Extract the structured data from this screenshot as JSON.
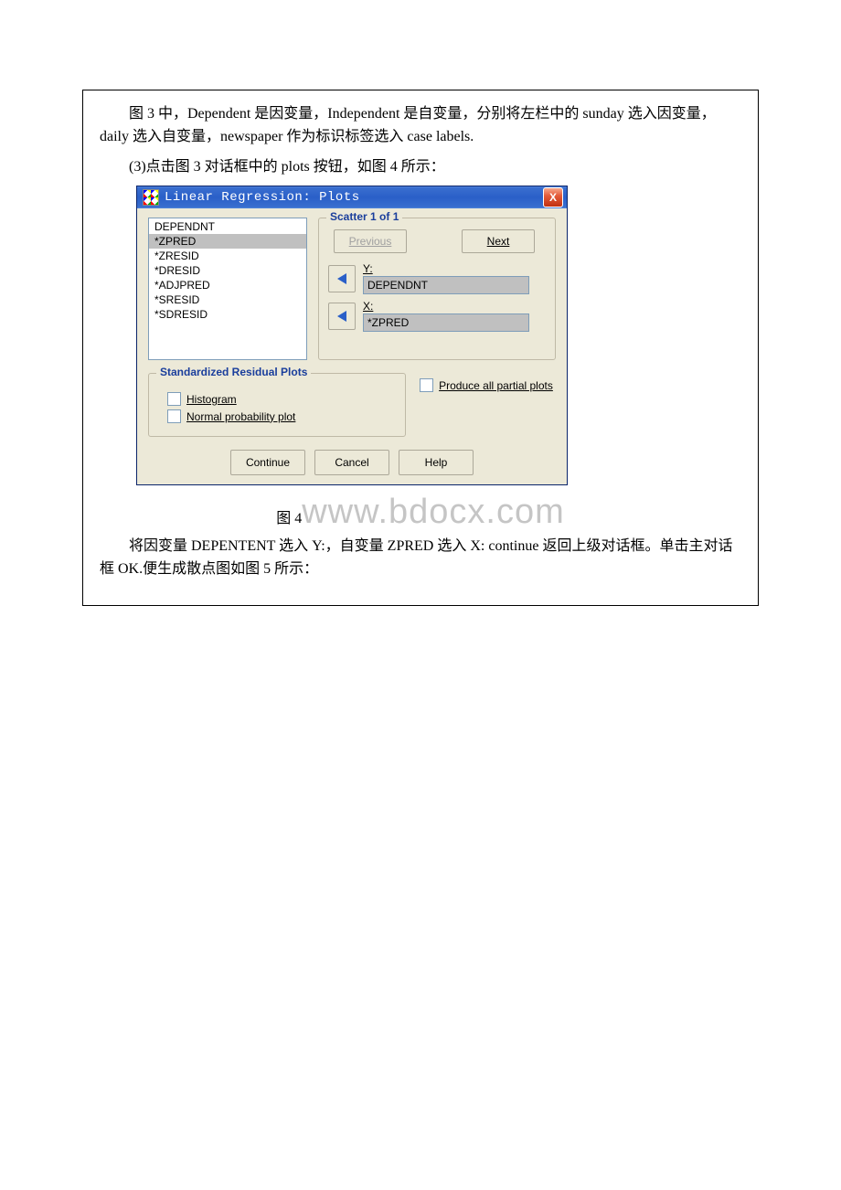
{
  "para1": "图 3 中，Dependent 是因变量，Independent 是自变量，分别将左栏中的 sunday 选入因变量，daily 选入自变量，newspaper 作为标识标签选入 case labels.",
  "para2": "(3)点击图 3 对话框中的 plots 按钮，如图 4 所示：",
  "dialog": {
    "title": "Linear Regression: Plots",
    "close_icon": "X",
    "list": [
      "DEPENDNT",
      "*ZPRED",
      "*ZRESID",
      "*DRESID",
      "*ADJPRED",
      "*SRESID",
      "*SDRESID"
    ],
    "sel_index": 1,
    "scatter": {
      "group_title": "Scatter 1 of 1",
      "prev": "Previous",
      "next": "Next",
      "y_label": "Y:",
      "y_value": "DEPENDNT",
      "x_label": "X:",
      "x_value": "*ZPRED"
    },
    "resid": {
      "group_title": "Standardized Residual Plots",
      "hist": "Histogram",
      "npp": "Normal probability plot"
    },
    "partial": "Produce all partial plots",
    "btn_continue": "Continue",
    "btn_cancel": "Cancel",
    "btn_help": "Help"
  },
  "fig_label": "图 4",
  "watermark": "www.bdocx.com",
  "para3": "将因变量 DEPENTENT 选入 Y:，自变量 ZPRED 选入 X: continue 返回上级对话框。单击主对话框 OK.便生成散点图如图 5 所示："
}
